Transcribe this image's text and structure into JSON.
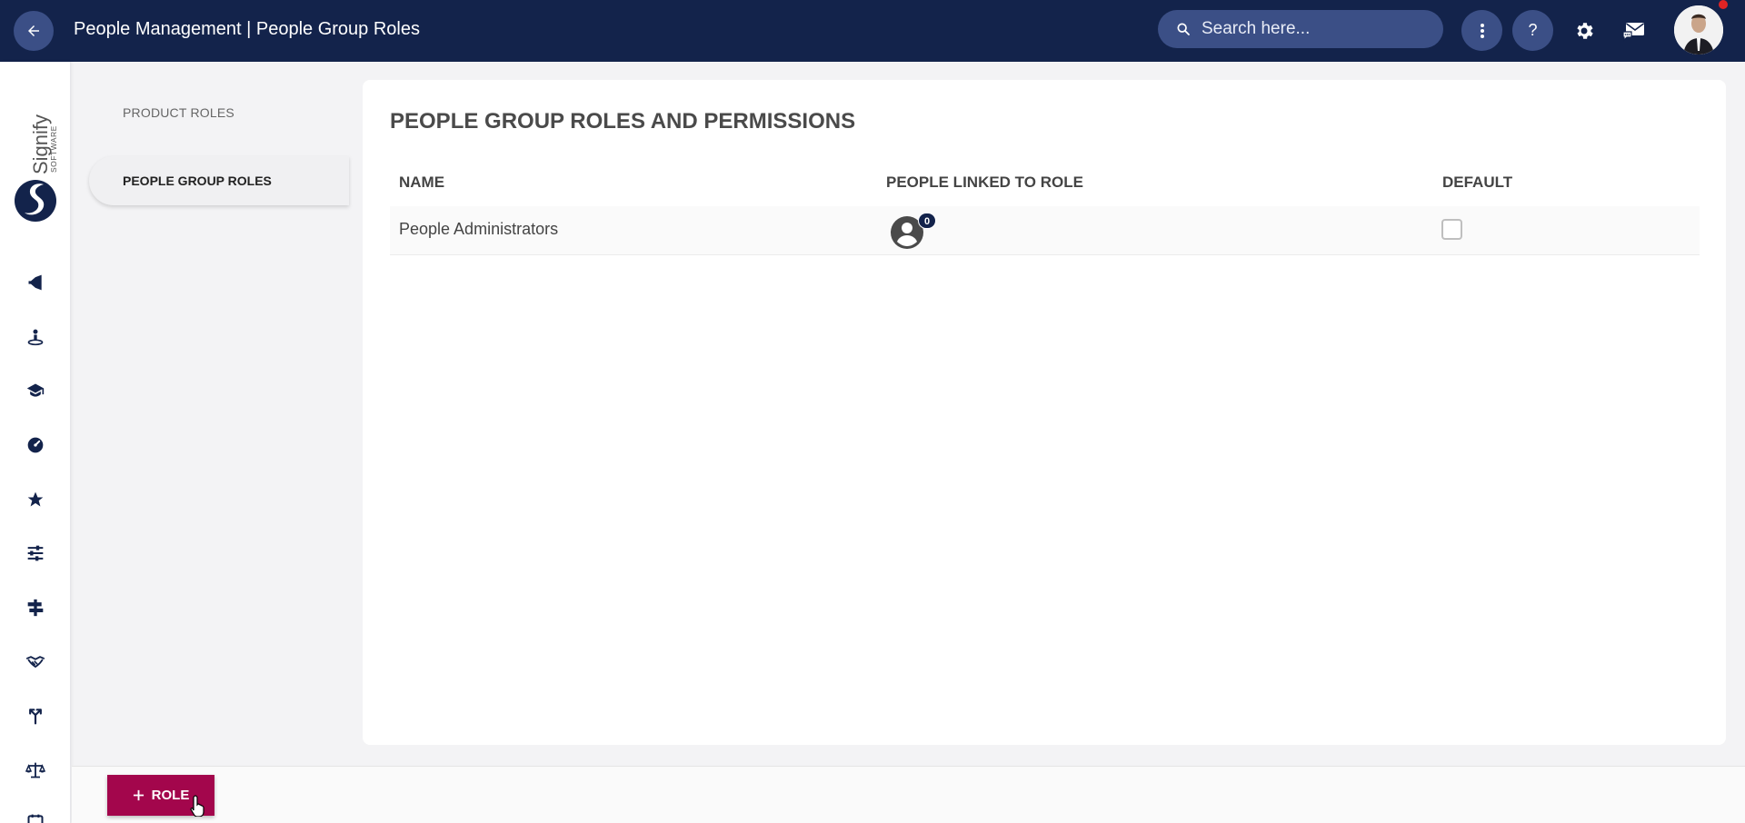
{
  "header": {
    "title": "People Management | People Group Roles",
    "search_placeholder": "Search here...",
    "help_label": "?"
  },
  "subnav": {
    "items": [
      {
        "label": "PRODUCT ROLES",
        "active": false
      },
      {
        "label": "PEOPLE GROUP ROLES",
        "active": true
      }
    ]
  },
  "main": {
    "title": "PEOPLE GROUP ROLES AND PERMISSIONS",
    "columns": [
      "NAME",
      "PEOPLE LINKED TO ROLE",
      "DEFAULT"
    ],
    "rows": [
      {
        "name": "People Administrators",
        "linked_count": "0",
        "default": false
      }
    ]
  },
  "footer": {
    "role_button_label": "ROLE"
  },
  "colors": {
    "topbar": "#13234b",
    "accent": "#a3064c",
    "circle_button": "#3b4f86"
  },
  "rail_icons": [
    "megaphone-icon",
    "person-pin-icon",
    "graduation-cap-icon",
    "dashboard-gauge-icon",
    "star-icon",
    "sliders-icon",
    "signpost-icon",
    "handshake-icon",
    "merge-arrows-icon",
    "scales-icon",
    "calendar-icon"
  ]
}
